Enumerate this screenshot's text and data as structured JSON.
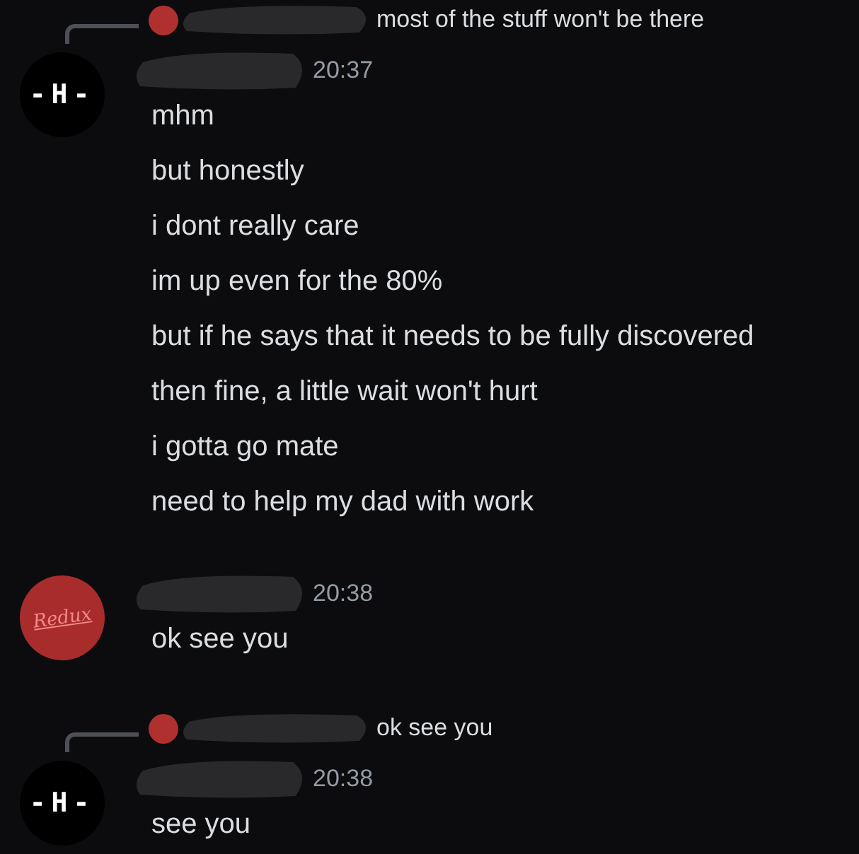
{
  "messages": [
    {
      "reply": {
        "kind": "redux",
        "text": "most of the stuff won't be there"
      },
      "avatar": {
        "kind": "h",
        "text": "-H-"
      },
      "time": "20:37",
      "lines": [
        "mhm",
        "but honestly",
        "i dont really care",
        "im up even for the 80%",
        "but if he says that it needs to be fully discovered",
        "then fine, a little wait won't hurt",
        "i gotta go mate",
        "need to help my dad with work"
      ]
    },
    {
      "avatar": {
        "kind": "redux",
        "text": "Redux"
      },
      "time": "20:38",
      "lines": [
        "ok see you"
      ]
    },
    {
      "reply": {
        "kind": "redux",
        "text": "ok see you"
      },
      "avatar": {
        "kind": "h",
        "text": "-H-"
      },
      "time": "20:38",
      "lines": [
        "see you"
      ]
    }
  ]
}
